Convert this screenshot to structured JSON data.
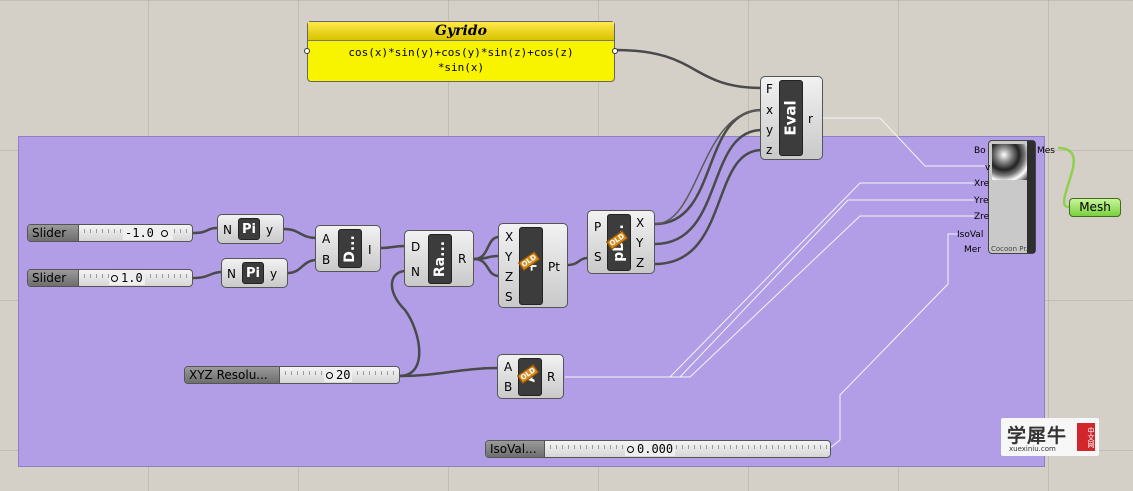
{
  "expression": {
    "title": "Gyrido",
    "line1": "cos(x)*sin(y)+cos(y)*sin(z)+cos(z)",
    "line2": "*sin(x)"
  },
  "eval": {
    "label": "Eval",
    "inputs": [
      "F",
      "x",
      "y",
      "z"
    ],
    "output": "r"
  },
  "sliders": {
    "slider1": {
      "label": "Slider",
      "value": "-1.0"
    },
    "slider2": {
      "label": "Slider",
      "value": "1.0"
    },
    "resolution": {
      "label": "XYZ  Resolu...",
      "value": "20"
    },
    "isoval": {
      "label": "IsoVal...",
      "value": "0.000"
    }
  },
  "pi1": {
    "label": "Pi",
    "in": "N",
    "out": "y"
  },
  "pi2": {
    "label": "Pi",
    "in": "N",
    "out": "y"
  },
  "domain": {
    "label": "D...",
    "inputs": [
      "A",
      "B"
    ],
    "output": "I"
  },
  "range": {
    "label": "Ra...",
    "inputs": [
      "D",
      "N"
    ],
    "output": "R"
  },
  "point": {
    "label": "Pt",
    "inputs": [
      "X",
      "Y",
      "Z",
      "S"
    ],
    "output": "Pt",
    "badge": "OLD"
  },
  "decompose": {
    "label": "pD...",
    "inputs": [
      "P",
      "S"
    ],
    "outputs": [
      "X",
      "Y",
      "Z"
    ],
    "badge": "OLD"
  },
  "add": {
    "label": "A",
    "inputs": [
      "A",
      "B"
    ],
    "output": "R",
    "badge": "OLD"
  },
  "mesh_component": {
    "inputs": [
      "Bo",
      "v",
      "Xre",
      "Yre",
      "Zre",
      "IsoVal",
      "Mer"
    ],
    "output": "Mes",
    "footer": "Cocoon Pr..."
  },
  "mesh_param": {
    "label": "Mesh"
  },
  "watermark": {
    "brand": "学犀牛",
    "site": "xuexiniu.com",
    "seal": "中文网"
  },
  "colors": {
    "group": "#b29ee6",
    "expression": "#f8f400",
    "mesh": "#7ad03e",
    "canvas": "#d4d0c8"
  }
}
